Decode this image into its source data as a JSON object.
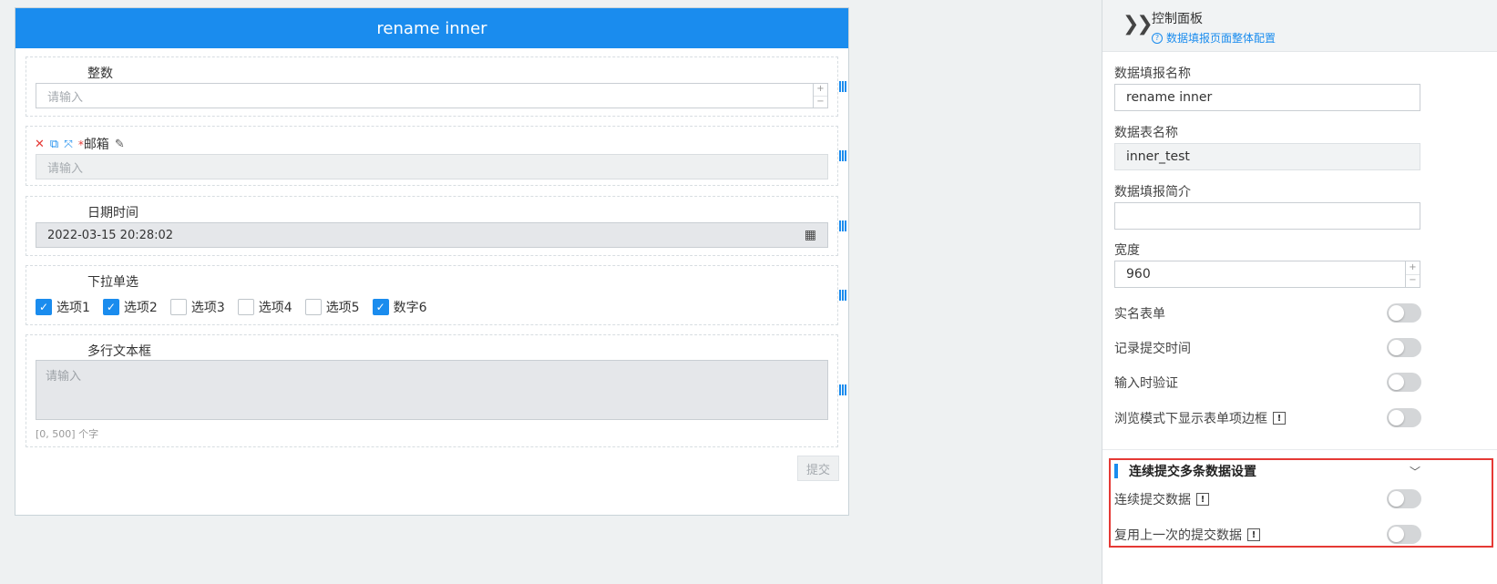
{
  "form": {
    "title": "rename inner",
    "fields": {
      "integer": {
        "label": "整数",
        "placeholder": "请输入",
        "plus": "+",
        "minus": "−"
      },
      "email": {
        "required_mark": "*",
        "label": "邮箱",
        "placeholder": "请输入"
      },
      "datetime": {
        "label": "日期时间",
        "value": "2022-03-15 20:28:02"
      },
      "dropdown": {
        "label": "下拉单选",
        "options": [
          {
            "label": "选项1",
            "checked": true
          },
          {
            "label": "选项2",
            "checked": true
          },
          {
            "label": "选项3",
            "checked": false
          },
          {
            "label": "选项4",
            "checked": false
          },
          {
            "label": "选项5",
            "checked": false
          },
          {
            "label": "数字6",
            "checked": true
          }
        ]
      },
      "textarea": {
        "label": "多行文本框",
        "placeholder": "请输入",
        "counter": "[0, 500] 个字"
      }
    },
    "submit_label": "提交"
  },
  "panel": {
    "title": "控制面板",
    "link": "数据填报页面整体配置",
    "name_label": "数据填报名称",
    "name_value": "rename inner",
    "table_label": "数据表名称",
    "table_value": "inner_test",
    "intro_label": "数据填报简介",
    "intro_value": "",
    "width_label": "宽度",
    "width_value": "960",
    "toggles": [
      {
        "label": "实名表单",
        "on": false,
        "info": false
      },
      {
        "label": "记录提交时间",
        "on": false,
        "info": false
      },
      {
        "label": "输入时验证",
        "on": false,
        "info": false
      },
      {
        "label": "浏览模式下显示表单项边框",
        "on": false,
        "info": true
      }
    ],
    "section": {
      "title": "连续提交多条数据设置",
      "toggles": [
        {
          "label": "连续提交数据",
          "on": false,
          "info": true
        },
        {
          "label": "复用上一次的提交数据",
          "on": false,
          "info": true
        }
      ]
    }
  },
  "colors": {
    "primary": "#1a8cee",
    "highlight_border": "#e53935"
  },
  "icons": {
    "delete": "close-icon",
    "copy": "copy-icon",
    "expand": "expand-icon",
    "edit": "pencil-icon",
    "calendar": "calendar-icon",
    "collapse": "double-chevron-right-icon",
    "help": "question-circle-icon",
    "info": "exclamation-icon",
    "drag": "drag-handle-icon",
    "section_toggle": "chevron-down-icon"
  }
}
